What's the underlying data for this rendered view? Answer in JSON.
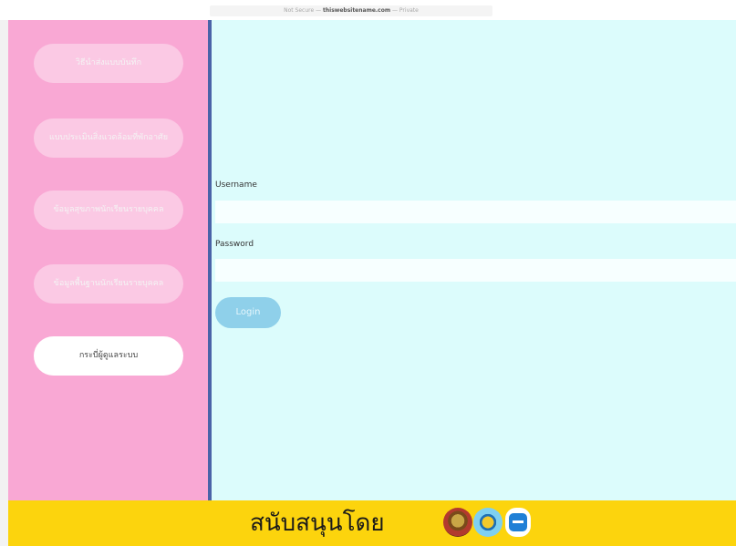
{
  "browser": {
    "url_prefix": "Not Secure — ",
    "url_host": "thiswebsitename.com",
    "url_suffix": " — Private"
  },
  "sidebar": {
    "items": [
      {
        "label": "วิธีนำส่งแบบบันทึก",
        "active": false
      },
      {
        "label": "แบบประเมินสิ่งแวดล้อมที่พักอาศัย",
        "active": false
      },
      {
        "label": "ข้อมูลสุขภาพนักเรียนรายบุคคล",
        "active": false
      },
      {
        "label": "ข้อมูลพื้นฐานนักเรียนรายบุคคล",
        "active": false
      },
      {
        "label": "กระบี่ผู้ดูแลระบบ",
        "active": true
      }
    ]
  },
  "login": {
    "username_label": "Username",
    "username_value": "",
    "password_label": "Password",
    "password_value": "",
    "button_label": "Login"
  },
  "footer": {
    "text": "สนับสนุนโดย",
    "logos": [
      "emblem-logo-1",
      "emblem-logo-2",
      "app-logo"
    ]
  },
  "colors": {
    "sidebar_bg": "#f9a8d4",
    "sidebar_button": "#fbc9e4",
    "main_bg": "#dcfcfc",
    "divider": "#4a63a8",
    "login_button": "#8fd0ea",
    "footer_bg": "#fcd40d"
  }
}
